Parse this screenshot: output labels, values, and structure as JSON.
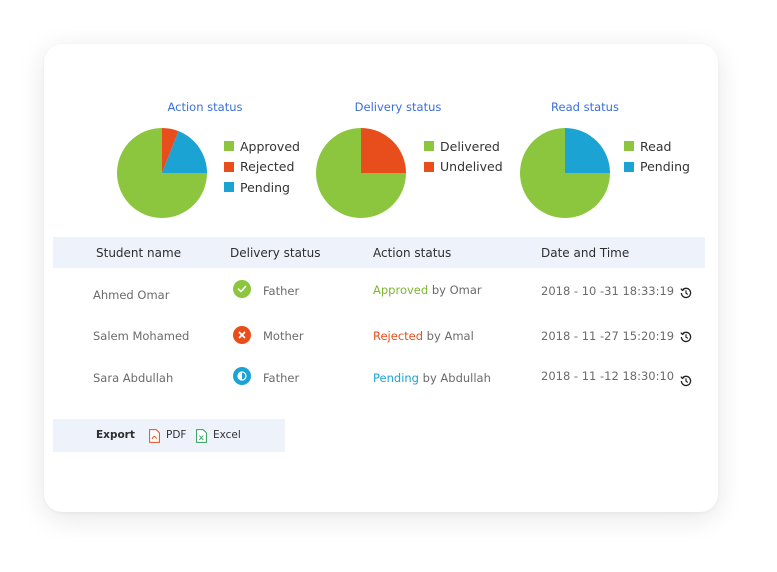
{
  "charts": [
    {
      "title": "Action status",
      "legend": [
        {
          "label": "Approved",
          "color": "#8cc63f"
        },
        {
          "label": "Rejected",
          "color": "#e84e1b"
        },
        {
          "label": "Pending",
          "color": "#1ba3d4"
        }
      ]
    },
    {
      "title": "Delivery status",
      "legend": [
        {
          "label": "Delivered",
          "color": "#8cc63f"
        },
        {
          "label": "Undelived",
          "color": "#e84e1b"
        }
      ]
    },
    {
      "title": "Read status",
      "legend": [
        {
          "label": "Read",
          "color": "#8cc63f"
        },
        {
          "label": "Pending",
          "color": "#1ba3d4"
        }
      ]
    }
  ],
  "chart_data": [
    {
      "type": "pie",
      "title": "Action status",
      "categories": [
        "Approved",
        "Rejected",
        "Pending"
      ],
      "values": [
        75,
        6,
        19
      ]
    },
    {
      "type": "pie",
      "title": "Delivery status",
      "categories": [
        "Delivered",
        "Undelived"
      ],
      "values": [
        75,
        25
      ]
    },
    {
      "type": "pie",
      "title": "Read status",
      "categories": [
        "Read",
        "Pending"
      ],
      "values": [
        75,
        25
      ]
    }
  ],
  "table": {
    "headers": [
      "Student name",
      "Delivery status",
      "Action status",
      "Date and Time"
    ],
    "rows": [
      {
        "student": "Ahmed Omar",
        "delivery_icon": "check-icon",
        "delivery": "Father",
        "action_status": "Approved",
        "action_by": " by Omar",
        "action_color": "#7cb82f",
        "datetime": "2018 - 10 -31  18:33:19"
      },
      {
        "student": "Salem Mohamed",
        "delivery_icon": "cross-icon",
        "delivery": "Mother",
        "action_status": "Rejected",
        "action_by": " by Amal",
        "action_color": "#e84e1b",
        "datetime": "2018 - 11 -27  15:20:19"
      },
      {
        "student": "Sara Abdullah",
        "delivery_icon": "half-circle-icon",
        "delivery": "Father",
        "action_status": "Pending",
        "action_by": " by Abdullah",
        "action_color": "#1ba3d4",
        "datetime": "2018 - 11 -12  18:30:10"
      }
    ]
  },
  "export": {
    "label": "Export",
    "pdf": "PDF",
    "excel": "Excel"
  },
  "colors": {
    "green": "#8cc63f",
    "red": "#e84e1b",
    "blue": "#1ba3d4",
    "title_blue": "#3a6fd8",
    "header_bg": "#eef2fb"
  }
}
